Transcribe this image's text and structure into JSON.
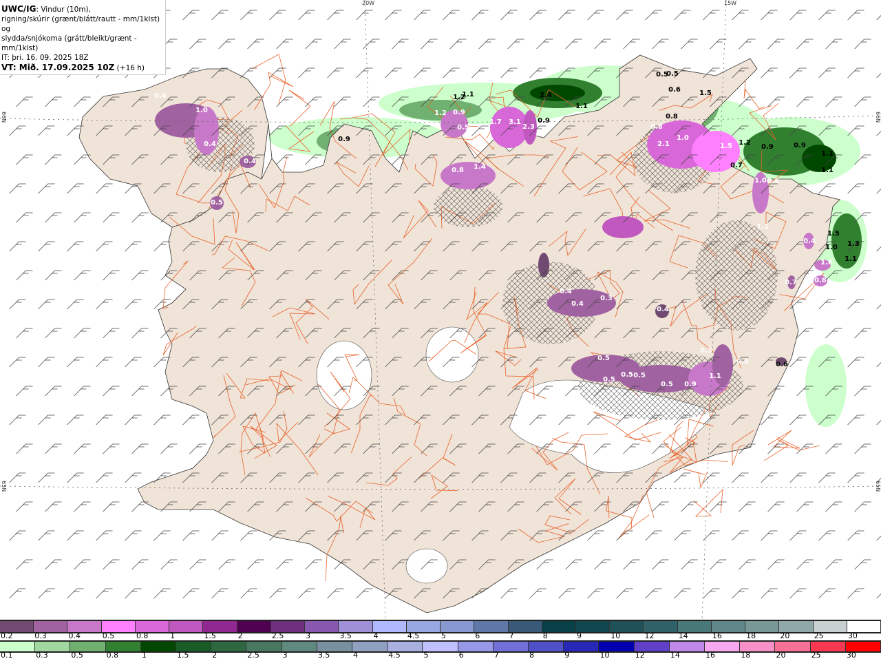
{
  "header": {
    "model": "UWC/IG",
    "line1": ": Vindur (10m),",
    "line2": "rigning/skúrir (grænt/blátt/rautt - mm/1klst) og",
    "line3": "slydda/snjókoma (grátt/bleikt/grænt - mm/1klst)",
    "init_time": "IT: þri. 16. 09. 2025 18Z",
    "valid_time": "VT: Mið. 17.09.2025 10Z",
    "lead": "(+16 h)"
  },
  "grid_labels": {
    "lon_20w": "20W",
    "lon_15w": "15W",
    "lat_66n_left": "66N",
    "lat_66n_right": "66N",
    "lat_65n_left": "65N",
    "lat_65n_right": "65N"
  },
  "colors": {
    "land": "#f0e3d7",
    "roads": "#e8622a",
    "sea": "#ffffff",
    "glacier": "#ffffff"
  },
  "map_labels": {
    "snow": [
      "0.4",
      "1.0",
      "0.4",
      "0.4",
      "0.5",
      "1.2",
      "0.9",
      "0.5",
      "0.8",
      "1.4",
      "1.7",
      "3.1",
      "2.3",
      "0.8",
      "2.1",
      "1.0",
      "1.5",
      "1.0",
      "0.6",
      "1.1",
      "0.4",
      "0.4",
      "0.3",
      "0.4",
      "0.5",
      "0.5",
      "0.5",
      "0.5",
      "0.5",
      "0.9",
      "1.1",
      "0.6",
      "0.3",
      "0.6",
      "1.6",
      "0.8",
      "0.7",
      "0.4"
    ],
    "rain": [
      "0.9",
      "1.2",
      "1.1",
      "2.4",
      "0.9",
      "1.1",
      "0.5",
      "0.5",
      "0.6",
      "1.5",
      "0.8",
      "0.9",
      "0.9",
      "1.1",
      "1.1",
      "0.7",
      "1.5",
      "1.0",
      "1.3",
      "1.1",
      "0.6",
      "1.2"
    ]
  },
  "legend": {
    "snow": {
      "labels": [
        "0.2",
        "0.3",
        "0.4",
        "0.5",
        "0.8",
        "1",
        "1.5",
        "2",
        "2.5",
        "3",
        "3.5",
        "4",
        "4.5",
        "5",
        "6",
        "7",
        "8",
        "9",
        "10",
        "12",
        "14",
        "16",
        "18",
        "20",
        "25",
        "30"
      ],
      "colors": [
        "#704a70",
        "#a062a0",
        "#c878c8",
        "#ff80ff",
        "#d868d8",
        "#c058c0",
        "#902890",
        "#500050",
        "#703080",
        "#8858b0",
        "#a090d8",
        "#b0b8ff",
        "#98a8e0",
        "#8898d0",
        "#6078a8",
        "#3a5878",
        "#084048",
        "#104850",
        "#205058",
        "#306068",
        "#487878",
        "#608888",
        "#789898",
        "#90a8a8",
        "#c8d0d0",
        "#ffffff"
      ]
    },
    "rain": {
      "labels": [
        "0.1",
        "0.3",
        "0.5",
        "0.8",
        "1",
        "1.5",
        "2",
        "2.5",
        "3",
        "3.5",
        "4",
        "4.5",
        "5",
        "6",
        "7",
        "8",
        "9",
        "10",
        "12",
        "14",
        "16",
        "18",
        "20",
        "25",
        "30"
      ],
      "colors": [
        "#ccffcc",
        "#a0d8a0",
        "#70b070",
        "#308030",
        "#004800",
        "#1a5c28",
        "#2e6840",
        "#487860",
        "#608a80",
        "#7890a0",
        "#90a0c0",
        "#a8b0e0",
        "#c0c0ff",
        "#9898e8",
        "#7070d8",
        "#5050c8",
        "#2828b8",
        "#0000b0",
        "#6040c8",
        "#c088e8",
        "#f8a8f0",
        "#f890c8",
        "#f87098",
        "#f83850",
        "#ff0000"
      ]
    }
  }
}
